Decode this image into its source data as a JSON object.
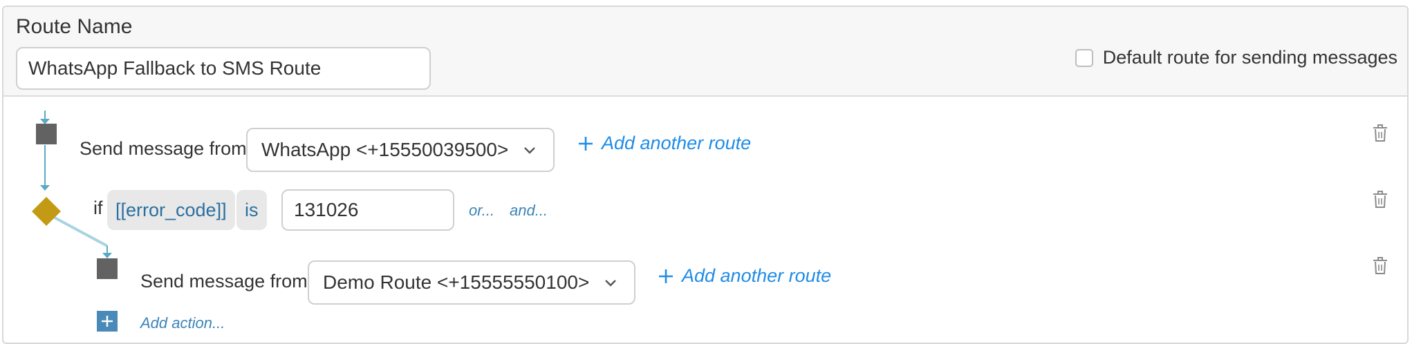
{
  "header": {
    "route_name_label": "Route Name",
    "route_name_value": "WhatsApp Fallback to SMS Route",
    "default_route_label": "Default route for sending messages",
    "default_route_checked": false
  },
  "flow": {
    "step1": {
      "label": "Send message from",
      "selected_route": "WhatsApp <+15550039500>",
      "add_route_label": "Add another route"
    },
    "condition": {
      "if_label": "if",
      "field": "[[error_code]]",
      "operator": "is",
      "value": "131026",
      "or_label": "or...",
      "and_label": "and..."
    },
    "step2": {
      "label": "Send message from",
      "selected_route": "Demo Route <+15555550100>",
      "add_route_label": "Add another route"
    },
    "add_action_label": "Add action..."
  },
  "colors": {
    "accent_link": "#1f8ce6",
    "pill_text": "#2a6fa0",
    "condition_diamond": "#c29a14",
    "connector": "#5aaac4",
    "node": "#626262"
  }
}
